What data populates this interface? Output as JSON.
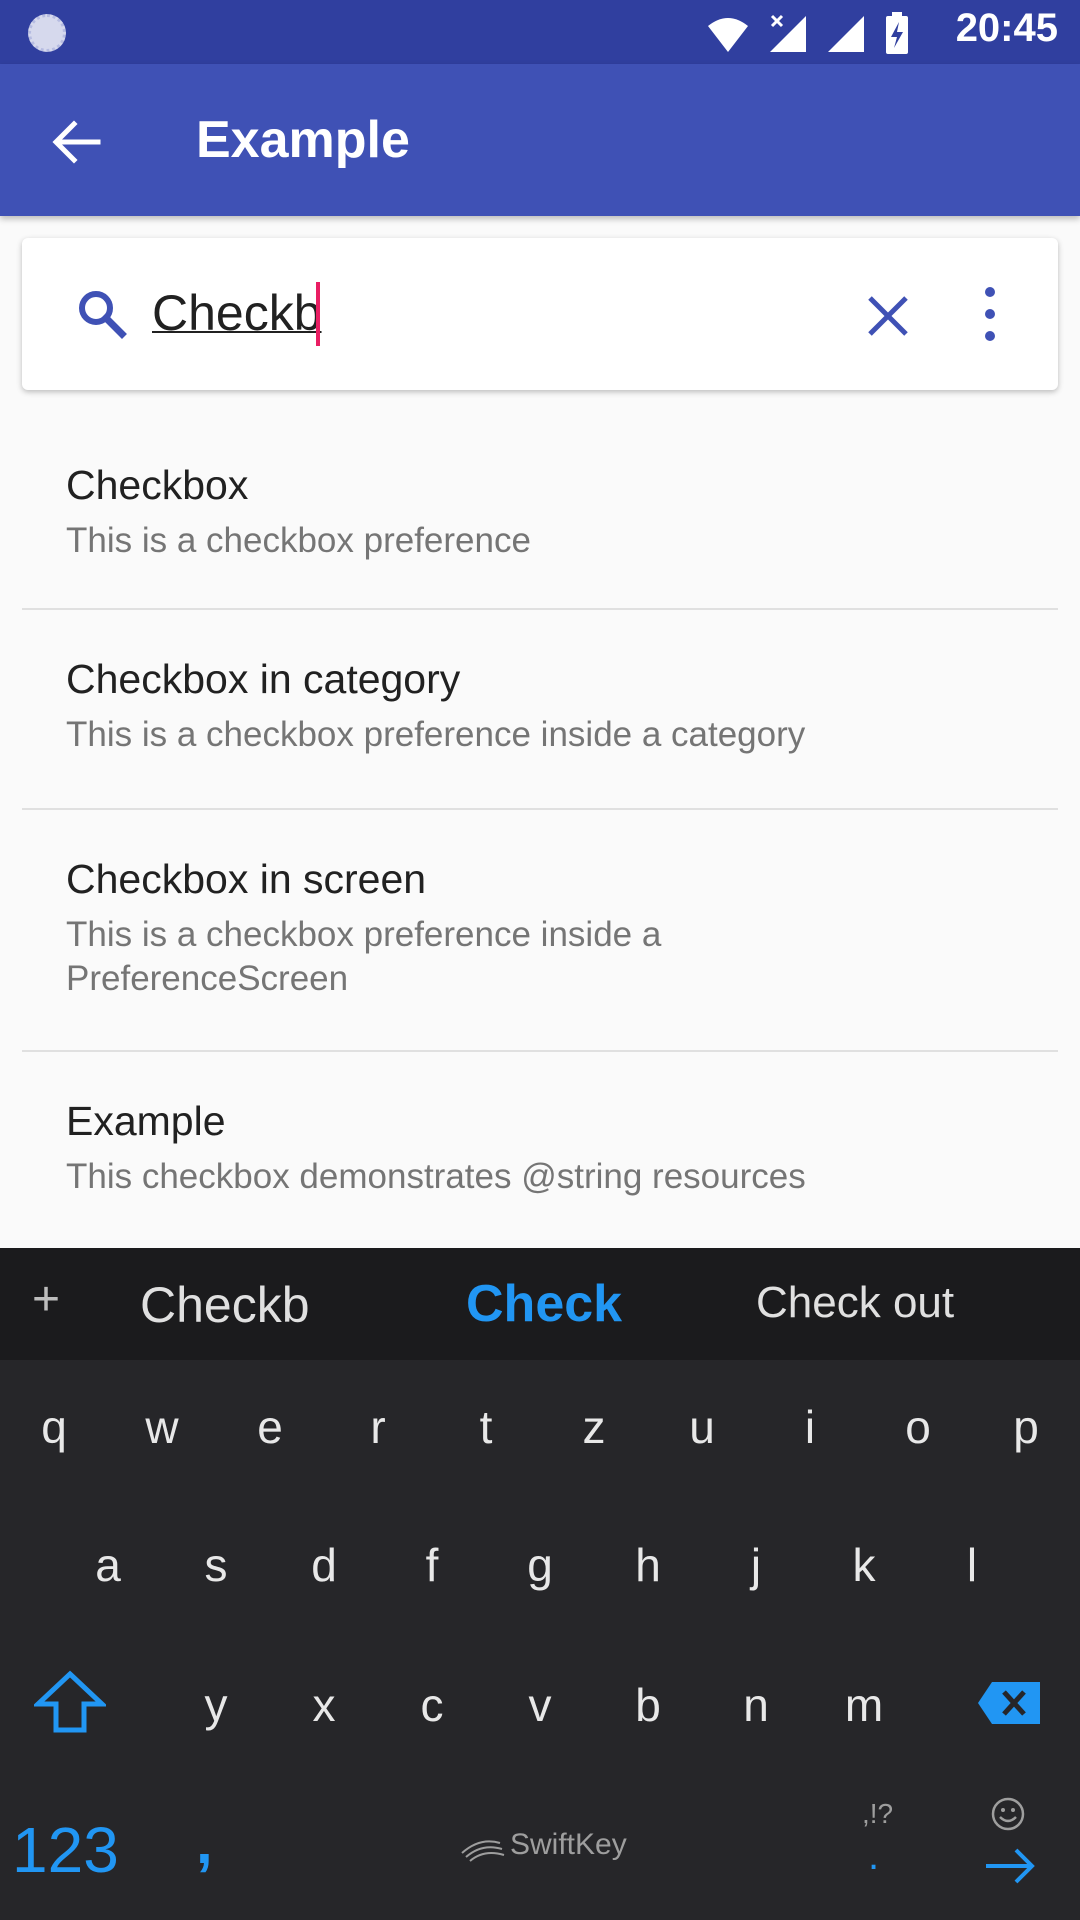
{
  "status_bar": {
    "time": "20:45",
    "icons": [
      "sync-icon",
      "wifi-icon",
      "no-signal-icon",
      "signal-icon",
      "battery-charging-icon"
    ]
  },
  "app_bar": {
    "title": "Example"
  },
  "search": {
    "query": "Checkb",
    "accent_color": "#3f51b5",
    "caret_color": "#e91e63"
  },
  "results": [
    {
      "title": "Checkbox",
      "summary": "This is a checkbox preference"
    },
    {
      "title": "Checkbox in category",
      "summary": "This is a checkbox preference inside a category"
    },
    {
      "title": "Checkbox in screen",
      "summary": "This is a checkbox preference inside a PreferenceScreen"
    },
    {
      "title": "Example",
      "summary": "This checkbox demonstrates @string resources"
    }
  ],
  "keyboard": {
    "suggestions": [
      "Checkb",
      "Check",
      "Check out"
    ],
    "row1": [
      "q",
      "w",
      "e",
      "r",
      "t",
      "z",
      "u",
      "i",
      "o",
      "p"
    ],
    "row2": [
      "a",
      "s",
      "d",
      "f",
      "g",
      "h",
      "j",
      "k",
      "l"
    ],
    "row3": [
      "y",
      "x",
      "c",
      "v",
      "b",
      "n",
      "m"
    ],
    "num_key": "123",
    "comma_key": ",",
    "punct_hint": ",!?",
    "period_key": ".",
    "brand": "SwiftKey",
    "accent_color": "#2196f3"
  }
}
